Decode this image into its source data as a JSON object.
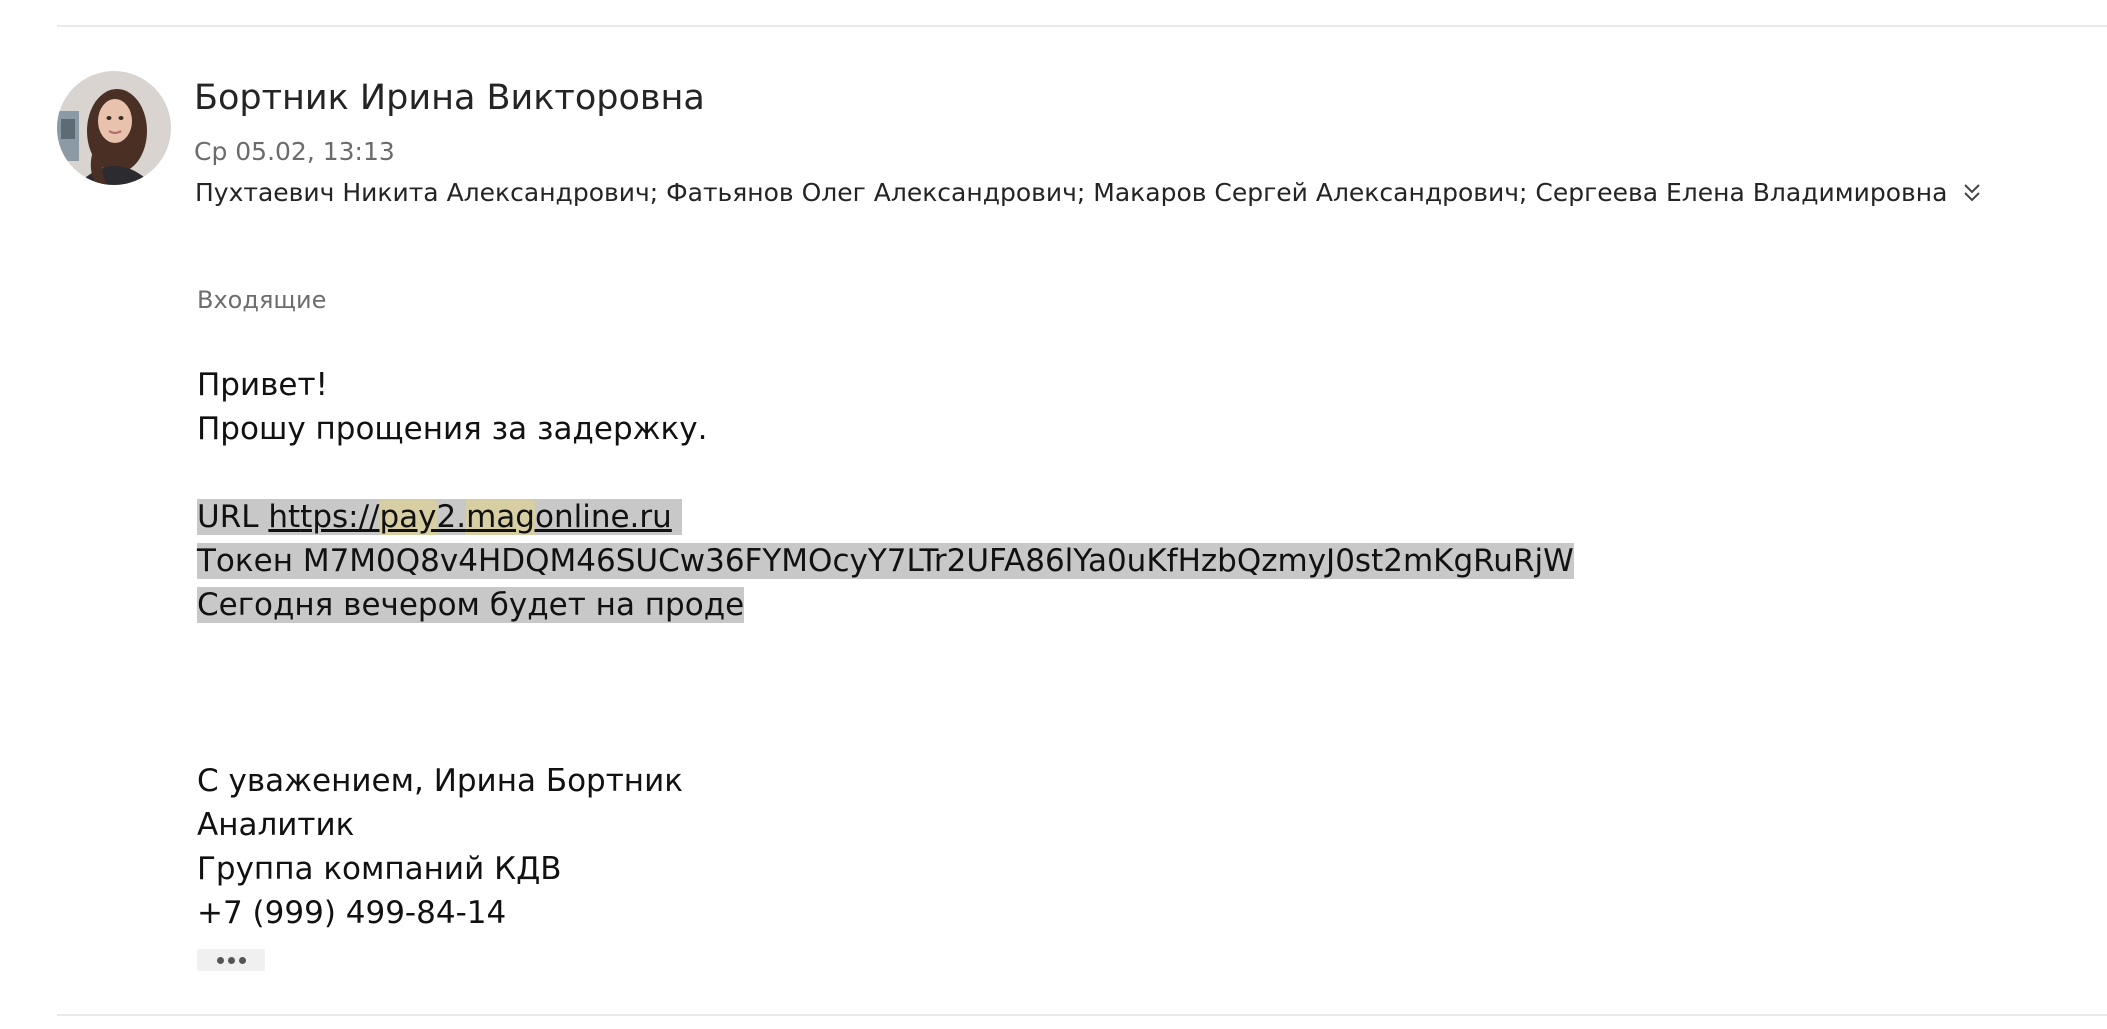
{
  "header": {
    "sender_name": "Бортник Ирина Викторовна",
    "datetime": "Ср 05.02, 13:13",
    "recipients": "Пухтаевич Никита Александрович; Фатьянов Олег Александрович; Макаров Сергей Александрович; Сергеева Елена Владимировна",
    "expand_icon": "chevron-double-down-icon"
  },
  "folder": "Входящие",
  "body": {
    "greeting": "Привет!",
    "apology": "Прошу прощения за задержку.",
    "url_label": "URL ",
    "url_parts": [
      "ht",
      "tps://",
      "pay",
      "2.",
      "mag",
      "online.ru"
    ],
    "token_line": "Токен M7M0Q8v4HDQM46SUCw36FYMOcyY7LTr2UFA86lYa0uKfHzbQzmyJ0st2mKgRuRjW",
    "prod_line": "Сегодня вечером будет на проде",
    "signature": [
      "С уважением, Ирина Бортник",
      "Аналитик",
      "Группа компаний КДВ",
      "+7 (999) 499-84-14"
    ]
  },
  "more_icon": "ellipsis-icon",
  "colors": {
    "selection": "#c8c8c8",
    "search_highlight": "#d7cfa3",
    "muted_text": "#6b6b6b"
  }
}
